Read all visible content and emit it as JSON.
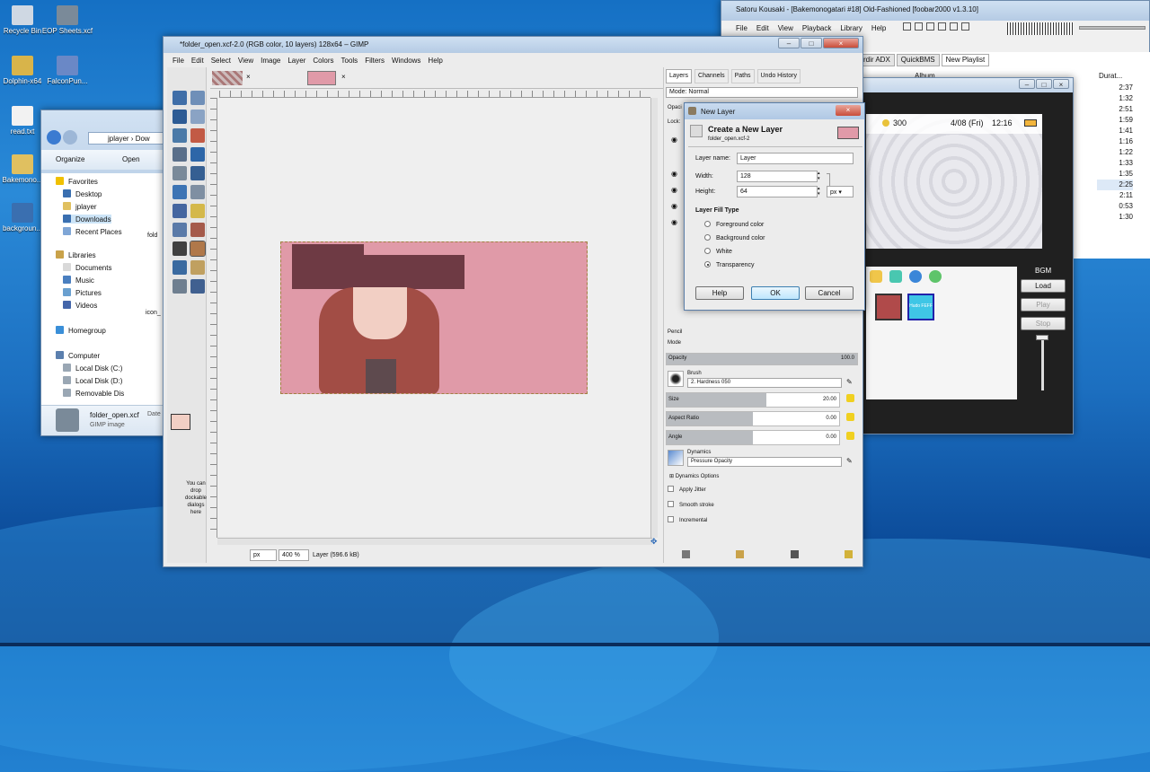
{
  "desktop": {
    "icons": [
      {
        "label": "Recycle Bin",
        "color": "#cfd8e3"
      },
      {
        "label": "EOP Sheets.xcf",
        "color": "#7a8a99"
      },
      {
        "label": "Dolphin-x64",
        "color": "#d8b44a"
      },
      {
        "label": "FalconPun...",
        "color": "#6a88c6"
      },
      {
        "label": "read.txt",
        "color": "#f2f2f2"
      },
      {
        "label": "Bakemono...",
        "color": "#e0c060"
      },
      {
        "label": "backgroun...",
        "color": "#3a6fb0"
      }
    ]
  },
  "explorer": {
    "address": [
      "jplayer",
      "Dow"
    ],
    "toolbar": {
      "organize": "Organize",
      "open": "Open"
    },
    "favorites": "Favorites",
    "fav_items": [
      "Desktop",
      "jplayer",
      "Downloads",
      "Recent Places"
    ],
    "libraries": "Libraries",
    "lib_items": [
      "Documents",
      "Music",
      "Pictures",
      "Videos"
    ],
    "homegroup": "Homegroup",
    "computer": "Computer",
    "comp_items": [
      "Local Disk (C:)",
      "Local Disk (D:)",
      "Removable Dis"
    ],
    "file_labels": [
      "fold",
      "icon_"
    ],
    "status_name": "folder_open.xcf",
    "status_type": "GIMP image",
    "status_date": "Date"
  },
  "foobar": {
    "title": "Satoru Kousaki - [Bakemonogatari #18] Old-Fashioned   [foobar2000 v1.3.10]",
    "menu": [
      "File",
      "Edit",
      "View",
      "Playback",
      "Library",
      "Help"
    ],
    "tabs": [
      "rdir ADX",
      "QuickBMS",
      "New Playlist"
    ],
    "col_album": "Album",
    "col_duration": "Durat...",
    "durations": [
      "2:37",
      "1:32",
      "2:51",
      "1:59",
      "1:41",
      "1:16",
      "1:22",
      "1:33",
      "1:35",
      "2:25",
      "2:11",
      "0:53",
      "1:30"
    ]
  },
  "game": {
    "coins": "300",
    "date": "4/08 (Fri)",
    "time": "12:16",
    "bgm_label": "BGM",
    "buttons": [
      "Load",
      "Play",
      "Stop"
    ],
    "thumb_label": "Hudo FEFF"
  },
  "gimp": {
    "title": "*folder_open.xcf-2.0 (RGB color, 10 layers) 128x64 – GIMP",
    "menu": [
      "File",
      "Edit",
      "Select",
      "View",
      "Image",
      "Layer",
      "Colors",
      "Tools",
      "Filters",
      "Windows",
      "Help"
    ],
    "dock_hint": "You can drop dockable dialogs here",
    "status": {
      "unit": "px",
      "zoom": "400 %",
      "layer_info": "Layer (596.6 kB)"
    },
    "colors": {
      "fg": "#f2cfc4",
      "bg": "#ffffff",
      "canvas": "#e09aa8",
      "hat": "#6e3a44",
      "hair": "#a24d45",
      "face": "#f2cfc4"
    }
  },
  "layers_dock": {
    "tabs": [
      "Layers",
      "Channels",
      "Paths",
      "Undo History"
    ],
    "mode": "Mode: Normal",
    "opacity_short": "Opaci",
    "lock": "Lock:",
    "pencil": "Pencil",
    "mode_short": "Mode",
    "opacity_label": "Opacity",
    "opacity_value": "100.0",
    "brush_label": "Brush",
    "brush_name": "2. Hardness 050",
    "size_label": "Size",
    "size_value": "20.00",
    "size_fraction": 0.58,
    "aspect_label": "Aspect Ratio",
    "aspect_value": "0.00",
    "angle_label": "Angle",
    "angle_value": "0.00",
    "dynamics_label": "Dynamics",
    "dynamics_name": "Pressure Opacity",
    "dynamics_options": "Dynamics Options",
    "options": [
      "Apply Jitter",
      "Smooth stroke",
      "Incremental"
    ]
  },
  "dialog": {
    "title": "New Layer",
    "heading": "Create a New Layer",
    "sub": "folder_open.xcf-2",
    "name_label": "Layer name:",
    "name_value": "Layer",
    "width_label": "Width:",
    "width_value": "128",
    "height_label": "Height:",
    "height_value": "64",
    "unit": "px",
    "fill_title": "Layer Fill Type",
    "fill_options": [
      "Foreground color",
      "Background color",
      "White",
      "Transparency"
    ],
    "selected_fill": "Transparency",
    "help": "Help",
    "ok": "OK",
    "cancel": "Cancel"
  }
}
